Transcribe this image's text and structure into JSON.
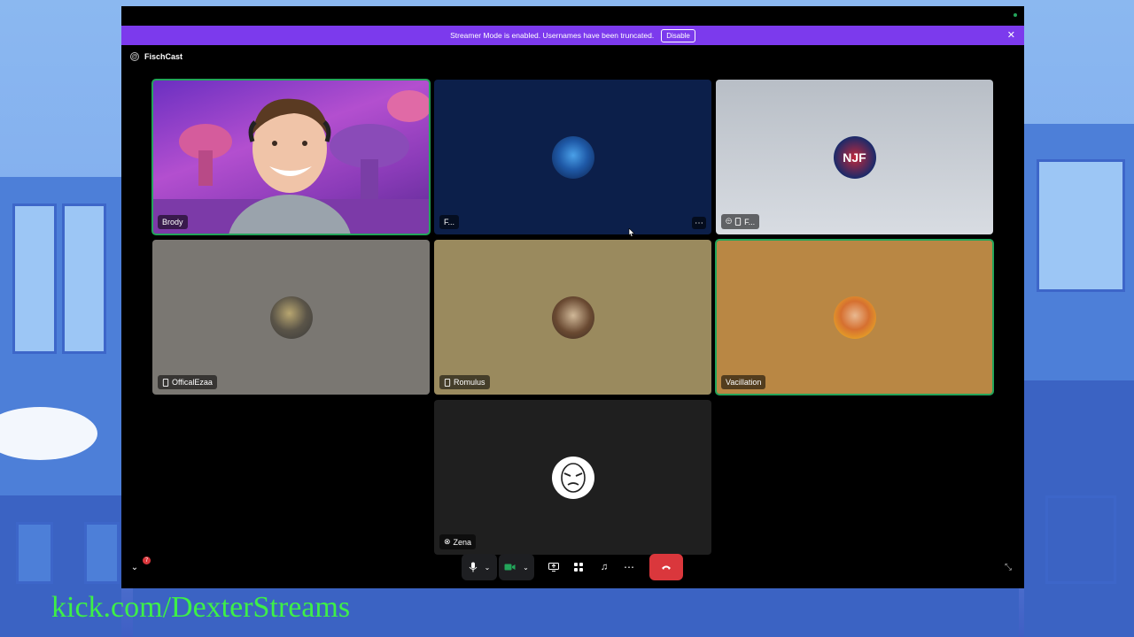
{
  "banner": {
    "message": "Streamer Mode is enabled. Usernames have been truncated.",
    "disable_label": "Disable",
    "close_icon": "close-icon"
  },
  "channel": {
    "name": "FischCast",
    "icon": "at-icon"
  },
  "participants": [
    {
      "name": "Brody",
      "video": true,
      "speaking": true,
      "bg": "#5b2aa0"
    },
    {
      "name": "F...",
      "video": false,
      "speaking": false,
      "bg": "#0c1f4a"
    },
    {
      "name": "F...",
      "video": false,
      "speaking": false,
      "bg": "#c6ccd4",
      "icons": [
        "deafened-icon",
        "mobile-icon"
      ]
    },
    {
      "name": "OfficalEzaa",
      "video": false,
      "speaking": false,
      "bg": "#7a7772",
      "icons": [
        "mobile-icon"
      ]
    },
    {
      "name": "Romulus",
      "video": false,
      "speaking": false,
      "bg": "#9a8a5e",
      "icons": [
        "mobile-icon"
      ]
    },
    {
      "name": "Vacillation",
      "video": false,
      "speaking": true,
      "bg": "#b98744"
    },
    {
      "name": "Zena",
      "video": false,
      "speaking": false,
      "bg": "#1f1f1f",
      "icons": [
        "xbox-icon"
      ]
    }
  ],
  "toolbar": {
    "notification_count": "7",
    "items": [
      "microphone-icon",
      "chevron-down-icon",
      "camera-icon",
      "chevron-down-icon",
      "screen-share-icon",
      "activities-icon",
      "soundboard-icon",
      "more-icon",
      "hang-up-icon",
      "collapse-icon"
    ]
  },
  "overlay": {
    "stream_url": "kick.com/DexterStreams"
  },
  "colors": {
    "accent": "#7c3aed",
    "speaking": "#23a55a",
    "hangup": "#da373c"
  }
}
